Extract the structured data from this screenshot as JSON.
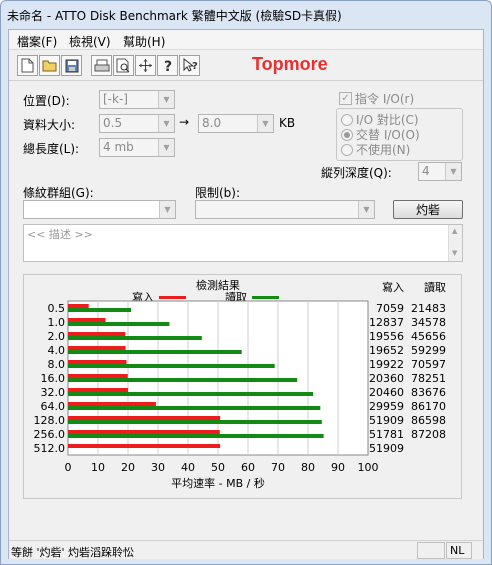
{
  "window": {
    "title": "未命名 - ATTO Disk Benchmark  繁體中文版 (檢驗SD卡真假)"
  },
  "menu": [
    "檔案(F)",
    "檢視(V)",
    "幫助(H)"
  ],
  "toolbar": {
    "icons": [
      "new-file-icon",
      "open-folder-icon",
      "save-icon",
      "print-icon",
      "print-preview-icon",
      "move-icon",
      "help-icon",
      "context-help-icon"
    ],
    "brand": "Topmore"
  },
  "settings": {
    "drive_label": "位置(D):",
    "drive_value": "[-k-]",
    "transfer_label": "資料大小:",
    "transfer_from": "0.5",
    "arrow": "→",
    "transfer_to": "8.0",
    "transfer_unit": "KB",
    "length_label": "總長度(L):",
    "length_value": "4 mb",
    "direct_io_label": "指令 I/O(r)",
    "io_compare_label": "I/O 對比(C)",
    "overlapped_io_label": "交替 I/O(O)",
    "neither_label": "不使用(N)",
    "queue_depth_label": "縱列深度(Q):",
    "queue_depth_value": "4",
    "controlled_by_label": "條紋群組(G):",
    "restrict_label": "限制(b):",
    "start_button": "灼砦",
    "description_placeholder": "<< 描述 >>"
  },
  "results": {
    "title": "檢測結果",
    "legend_write": "寫入",
    "legend_read": "讀取",
    "col_write": "寫入",
    "col_read": "讀取",
    "xlabel": "平均速率 - MB / 秒",
    "colors": {
      "write": "#ee1c1c",
      "read": "#138a13"
    }
  },
  "chart_data": {
    "type": "bar",
    "orientation": "horizontal",
    "title": "檢測結果",
    "xlabel": "平均速率 - MB / 秒",
    "xlim": [
      0,
      100
    ],
    "xticks": [
      0,
      10,
      20,
      30,
      40,
      50,
      60,
      70,
      80,
      90,
      100
    ],
    "grid": true,
    "categories": [
      "0.5",
      "1.0",
      "2.0",
      "4.0",
      "8.0",
      "16.0",
      "32.0",
      "64.0",
      "128.0",
      "256.0",
      "512.0"
    ],
    "series": [
      {
        "name": "寫入",
        "color": "#ee1c1c",
        "values": [
          6.9,
          12.5,
          19.1,
          19.2,
          19.5,
          19.9,
          20.0,
          29.3,
          50.7,
          50.6,
          50.7
        ]
      },
      {
        "name": "讀取",
        "color": "#138a13",
        "values": [
          21.0,
          33.8,
          44.6,
          57.9,
          68.9,
          76.4,
          81.7,
          84.1,
          84.6,
          85.2,
          null
        ]
      }
    ],
    "table": {
      "write": [
        "7059",
        "12837",
        "19556",
        "19652",
        "19922",
        "20360",
        "20460",
        "29959",
        "51909",
        "51781",
        "51909"
      ],
      "read": [
        "21483",
        "34578",
        "45656",
        "59299",
        "70597",
        "78251",
        "83676",
        "86170",
        "86598",
        "87208",
        ""
      ]
    }
  },
  "status": {
    "text": "等餅 '灼砦' 灼砦滔跺聆忪",
    "pane_mode": "NL"
  }
}
